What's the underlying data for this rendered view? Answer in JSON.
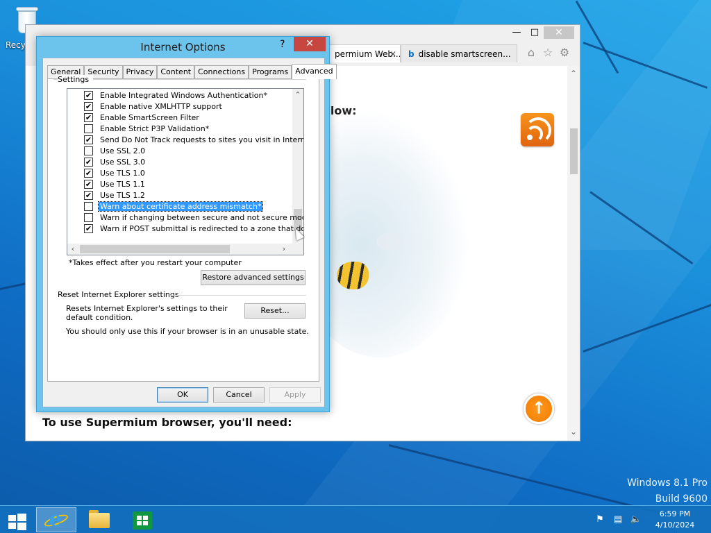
{
  "desktop": {
    "recycle_bin_label": "Recyc",
    "watermark_line1": "Windows 8.1 Pro",
    "watermark_line2": "Build 9600"
  },
  "browser": {
    "tabs": [
      {
        "label": "permium Web...",
        "close": "✕"
      },
      {
        "label": "disable smartscreen...",
        "icon": "b"
      }
    ],
    "page_heading_fragment": "elow:",
    "page_heading_bottom": "To use Supermium browser, you'll need:",
    "tools": [
      "home-icon",
      "star-icon",
      "gear-icon"
    ]
  },
  "dialog": {
    "title": "Internet Options",
    "help": "?",
    "close": "✕",
    "tabs": [
      "General",
      "Security",
      "Privacy",
      "Content",
      "Connections",
      "Programs",
      "Advanced"
    ],
    "active_tab": "Advanced",
    "settings_label": "Settings",
    "settings": [
      {
        "label": "Enable Integrated Windows Authentication*",
        "checked": true
      },
      {
        "label": "Enable native XMLHTTP support",
        "checked": true
      },
      {
        "label": "Enable SmartScreen Filter",
        "checked": true
      },
      {
        "label": "Enable Strict P3P Validation*",
        "checked": false
      },
      {
        "label": "Send Do Not Track requests to sites you visit in Internet E",
        "checked": true
      },
      {
        "label": "Use SSL 2.0",
        "checked": false
      },
      {
        "label": "Use SSL 3.0",
        "checked": true
      },
      {
        "label": "Use TLS 1.0",
        "checked": true
      },
      {
        "label": "Use TLS 1.1",
        "checked": true
      },
      {
        "label": "Use TLS 1.2",
        "checked": true
      },
      {
        "label": "Warn about certificate address mismatch*",
        "checked": false,
        "selected": true
      },
      {
        "label": "Warn if changing between secure and not secure mode",
        "checked": false
      },
      {
        "label": "Warn if POST submittal is redirected to a zone that does n",
        "checked": true
      }
    ],
    "restart_note": "*Takes effect after you restart your computer",
    "restore_button": "Restore advanced settings",
    "reset_group_label": "Reset Internet Explorer settings",
    "reset_desc": "Resets Internet Explorer's settings to their default condition.",
    "reset_button": "Reset...",
    "reset_warning": "You should only use this if your browser is in an unusable state.",
    "ok_button": "OK",
    "cancel_button": "Cancel",
    "apply_button": "Apply"
  },
  "taskbar": {
    "time": "6:59 PM",
    "date": "4/10/2024",
    "apps": [
      "internet-explorer",
      "file-explorer",
      "store"
    ],
    "tray": [
      "flag-icon",
      "network-icon",
      "volume-muted-icon"
    ]
  }
}
